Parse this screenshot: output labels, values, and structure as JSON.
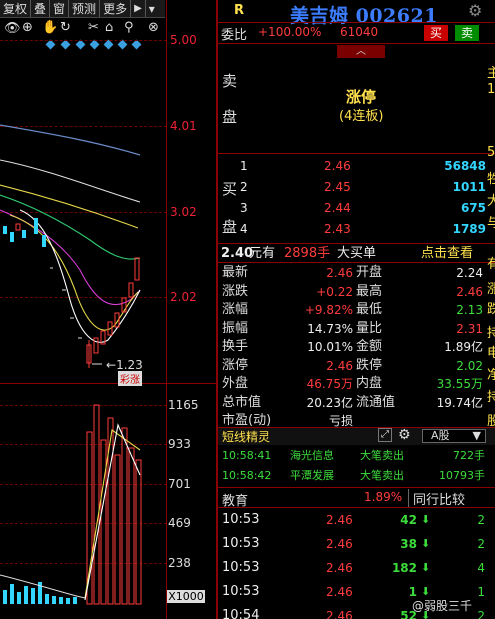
{
  "toolbar": {
    "items": [
      "复权",
      "叠",
      "窗",
      "预测",
      "更多"
    ],
    "pin": "▶",
    "arrow": "▾"
  },
  "chart": {
    "price_axis": [
      "5.00",
      "4.01",
      "3.02",
      "2.02"
    ],
    "low_label": "1.23",
    "limit_tag": "涨",
    "volume_axis": [
      "1165",
      "933",
      "701",
      "469",
      "238"
    ],
    "volume_unit": "X1000"
  },
  "header": {
    "market_letter": "R",
    "title": "美吉姆 002621"
  },
  "order_book": {
    "weibi_label": "委比",
    "weibi_value": "+100.00%",
    "weicha_value": "61040",
    "buy_btn": "买",
    "sell_btn": "卖",
    "sell_label": [
      "卖",
      "盘"
    ],
    "limit_up": "涨停",
    "limit_up_sub": "(4连板)",
    "buy_label": [
      "买",
      "盘"
    ],
    "bids": [
      {
        "level": "1",
        "price": "2.46",
        "qty": "56848"
      },
      {
        "level": "2",
        "price": "2.45",
        "qty": "1011"
      },
      {
        "level": "3",
        "price": "2.44",
        "qty": "675"
      },
      {
        "level": "4",
        "price": "2.43",
        "qty": "1789"
      }
    ]
  },
  "big_order": {
    "price": "2.40",
    "unit1": "元有",
    "qty": "2898手",
    "label": "大买单",
    "link": "点击查看"
  },
  "stats": [
    {
      "l1": "最新",
      "v1": "2.46",
      "c1": "red",
      "l2": "开盘",
      "v2": "2.24",
      "c2": "white"
    },
    {
      "l1": "涨跌",
      "v1": "+0.22",
      "c1": "red",
      "l2": "最高",
      "v2": "2.46",
      "c2": "red"
    },
    {
      "l1": "涨幅",
      "v1": "+9.82%",
      "c1": "red",
      "l2": "最低",
      "v2": "2.13",
      "c2": "green"
    },
    {
      "l1": "振幅",
      "v1": "14.73%",
      "c1": "white",
      "l2": "量比",
      "v2": "2.31",
      "c2": "red"
    },
    {
      "l1": "换手",
      "v1": "10.01%",
      "c1": "white",
      "l2": "金额",
      "v2": "1.89亿",
      "c2": "white"
    },
    {
      "l1": "涨停",
      "v1": "2.46",
      "c1": "red",
      "l2": "跌停",
      "v2": "2.02",
      "c2": "green"
    },
    {
      "l1": "外盘",
      "v1": "46.75万",
      "c1": "red",
      "l2": "内盘",
      "v2": "33.55万",
      "c2": "green"
    },
    {
      "l1": "总市值",
      "v1": "20.23亿",
      "c1": "white",
      "l2": "流通值",
      "v2": "19.74亿",
      "c2": "white"
    },
    {
      "l1": "市盈(动)",
      "v1": "亏损",
      "c1": "white",
      "l2": "",
      "v2": "",
      "c2": "white"
    }
  ],
  "tabs": {
    "title": "短线精灵",
    "market": "A股"
  },
  "feed": [
    {
      "time": "10:58:41",
      "name": "海光信息",
      "action": "大笔卖出",
      "qty": "722手"
    },
    {
      "time": "10:58:42",
      "name": "平潭发展",
      "action": "大笔卖出",
      "qty": "10793手"
    }
  ],
  "industry": {
    "name": "教育",
    "pct": "1.89%",
    "compare": "同行比较"
  },
  "ticks": [
    {
      "time": "10:53",
      "price": "2.46",
      "vol": "42",
      "n": "2"
    },
    {
      "time": "10:53",
      "price": "2.46",
      "vol": "38",
      "n": "2"
    },
    {
      "time": "10:53",
      "price": "2.46",
      "vol": "182",
      "n": "4"
    },
    {
      "time": "10:53",
      "price": "2.46",
      "vol": "1",
      "n": "1"
    },
    {
      "time": "10:54",
      "price": "2.46",
      "vol": "52",
      "n": "2"
    }
  ],
  "side_tags": [
    "主",
    "1",
    "5",
    "牲",
    "大",
    "与",
    "有",
    "涨",
    "跌",
    "持",
    "电",
    "净",
    "持",
    "股"
  ],
  "watermark": "@弱股三千"
}
